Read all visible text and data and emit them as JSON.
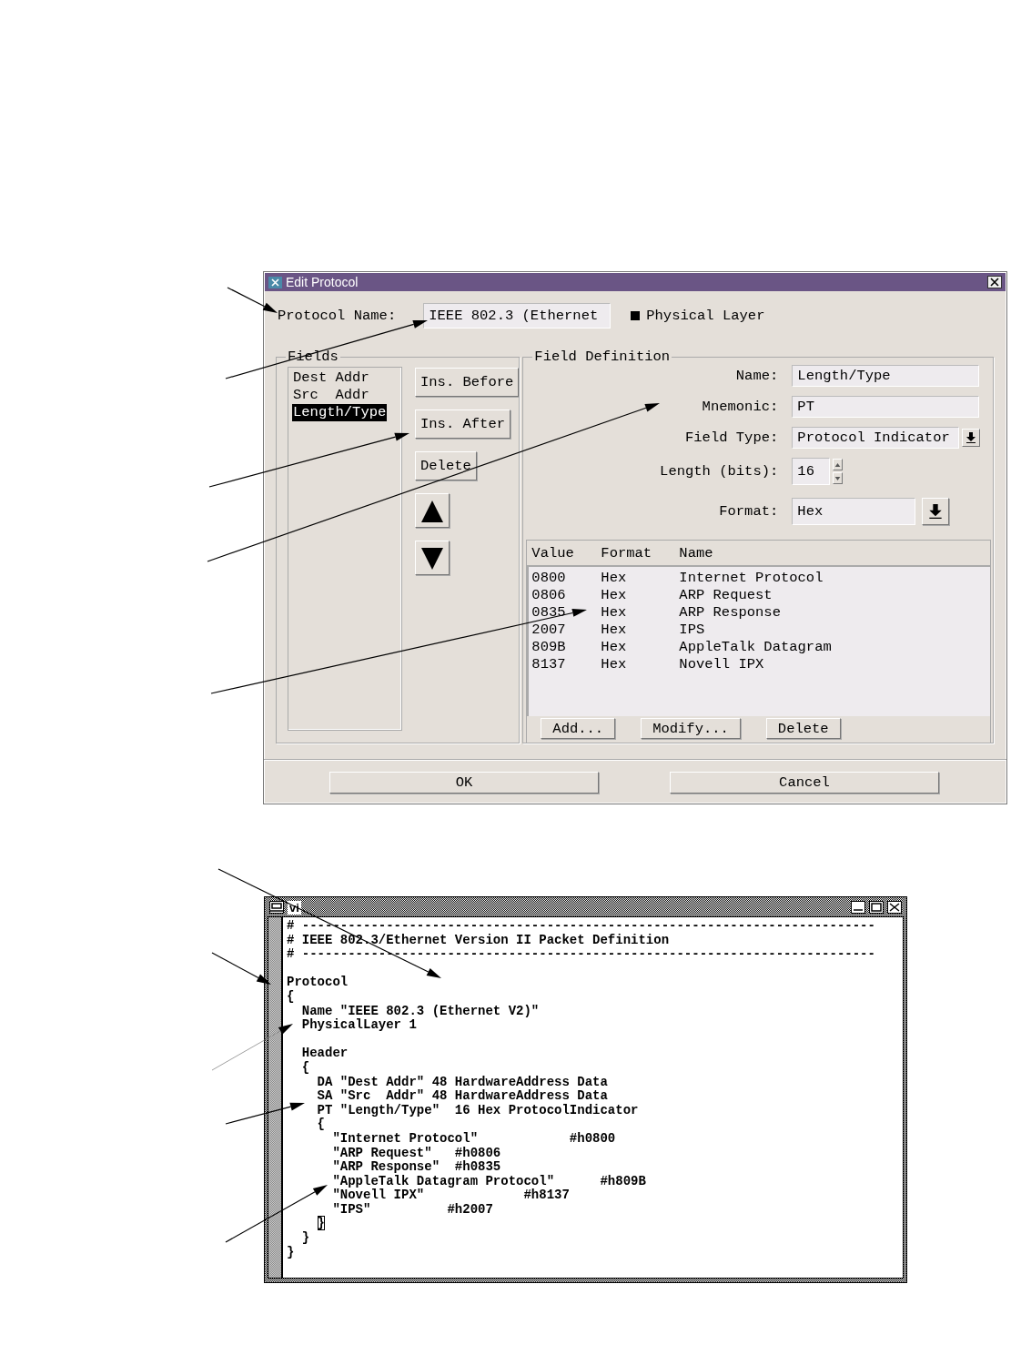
{
  "edit_protocol": {
    "title": "Edit Protocol",
    "protocol_name_label": "Protocol Name:",
    "protocol_name": "IEEE 802.3 (Ethernet",
    "physical_layer": {
      "label": "Physical Layer",
      "checked": true
    },
    "fields": {
      "title": "Fields",
      "items": [
        {
          "label": "Dest Addr",
          "selected": false
        },
        {
          "label": "Src  Addr",
          "selected": false
        },
        {
          "label": "Length/Type",
          "selected": true
        }
      ],
      "buttons": [
        "Ins. Before",
        "Ins. After",
        "Delete"
      ]
    },
    "field_definition": {
      "title": "Field Definition",
      "rows": [
        {
          "kind": "text",
          "label": "Name:",
          "value": "Length/Type"
        },
        {
          "kind": "text",
          "label": "Mnemonic:",
          "value": "PT"
        },
        {
          "kind": "dropdown",
          "label": "Field Type:",
          "value": "Protocol Indicator"
        },
        {
          "kind": "spinner",
          "label": "Length (bits):",
          "value": "16"
        },
        {
          "kind": "combo",
          "label": "Format:",
          "value": "Hex"
        }
      ],
      "table": {
        "columns": [
          "Value",
          "Format",
          "Name"
        ],
        "rows": [
          [
            "0800",
            "Hex",
            "Internet Protocol"
          ],
          [
            "0806",
            "Hex",
            "ARP Request"
          ],
          [
            "0835",
            "Hex",
            "ARP Response"
          ],
          [
            "2007",
            "Hex",
            "IPS"
          ],
          [
            "809B",
            "Hex",
            "AppleTalk Datagram"
          ],
          [
            "8137",
            "Hex",
            "Novell IPX"
          ]
        ]
      },
      "buttons": [
        "Add...",
        "Modify...",
        "Delete"
      ]
    },
    "buttons": [
      "OK",
      "Cancel"
    ]
  },
  "vi_window": {
    "title": "vi",
    "lines": [
      {
        "kind": "code",
        "text": "# ---------------------------------------------------------------------------",
        "cursor": false
      },
      {
        "kind": "code",
        "text": "# IEEE 802.3/Ethernet Version II Packet Definition",
        "cursor": false
      },
      {
        "kind": "code",
        "text": "# ---------------------------------------------------------------------------",
        "cursor": false
      },
      {
        "kind": "blank"
      },
      {
        "kind": "code",
        "text": "Protocol",
        "cursor": false
      },
      {
        "kind": "code",
        "text": "{",
        "cursor": false
      },
      {
        "kind": "code",
        "text": "  Name \"IEEE 802.3 (Ethernet V2)\"",
        "cursor": false
      },
      {
        "kind": "code",
        "text": "  PhysicalLayer 1",
        "cursor": false
      },
      {
        "kind": "blank"
      },
      {
        "kind": "code",
        "text": "  Header",
        "cursor": false
      },
      {
        "kind": "code",
        "text": "  {",
        "cursor": false
      },
      {
        "kind": "code",
        "text": "    DA \"Dest Addr\" 48 HardwareAddress Data",
        "cursor": false
      },
      {
        "kind": "code",
        "text": "    SA \"Src  Addr\" 48 HardwareAddress Data",
        "cursor": false
      },
      {
        "kind": "code",
        "text": "    PT \"Length/Type\"  16 Hex ProtocolIndicator",
        "cursor": false
      },
      {
        "kind": "code",
        "text": "    {",
        "cursor": false
      },
      {
        "kind": "code",
        "text": "      \"Internet Protocol\"            #h0800",
        "cursor": false
      },
      {
        "kind": "code",
        "text": "      \"ARP Request\"   #h0806",
        "cursor": false
      },
      {
        "kind": "code",
        "text": "      \"ARP Response\"  #h0835",
        "cursor": false
      },
      {
        "kind": "code",
        "text": "      \"AppleTalk Datagram Protocol\"      #h809B",
        "cursor": false
      },
      {
        "kind": "code",
        "text": "      \"Novell IPX\"             #h8137",
        "cursor": false
      },
      {
        "kind": "code",
        "text": "      \"IPS\"          #h2007",
        "cursor": false
      },
      {
        "kind": "code",
        "text": "    }",
        "cursor": true
      },
      {
        "kind": "code",
        "text": "  }",
        "cursor": false
      },
      {
        "kind": "code",
        "text": "}",
        "cursor": false
      }
    ]
  }
}
